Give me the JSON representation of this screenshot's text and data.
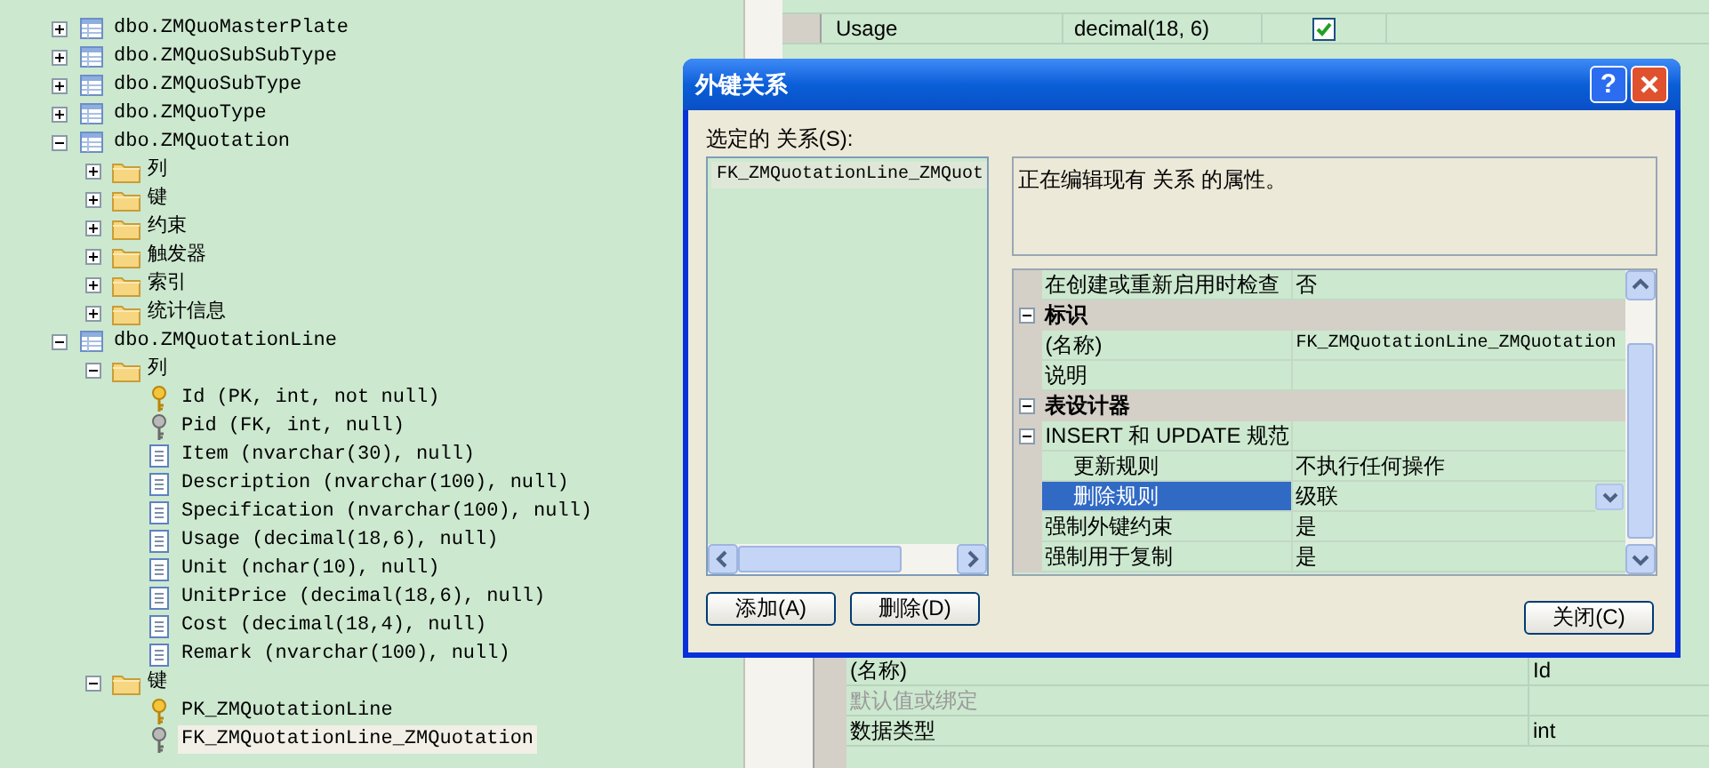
{
  "tree": [
    {
      "label": "dbo.ZMQuoMasterPlate",
      "kind": "table",
      "expanded": false,
      "selected": false
    },
    {
      "label": "dbo.ZMQuoSubSubType",
      "kind": "table",
      "expanded": false,
      "selected": false
    },
    {
      "label": "dbo.ZMQuoSubType",
      "kind": "table",
      "expanded": false,
      "selected": false
    },
    {
      "label": "dbo.ZMQuoType",
      "kind": "table",
      "expanded": false,
      "selected": false
    },
    {
      "label": "dbo.ZMQuotation",
      "kind": "table",
      "expanded": true,
      "selected": false,
      "children": [
        {
          "label": "列",
          "kind": "folder",
          "expanded": false,
          "selected": false
        },
        {
          "label": "键",
          "kind": "folder",
          "expanded": false,
          "selected": false
        },
        {
          "label": "约束",
          "kind": "folder",
          "expanded": false,
          "selected": false
        },
        {
          "label": "触发器",
          "kind": "folder",
          "expanded": false,
          "selected": false
        },
        {
          "label": "索引",
          "kind": "folder",
          "expanded": false,
          "selected": false
        },
        {
          "label": "统计信息",
          "kind": "folder",
          "expanded": false,
          "selected": false
        }
      ]
    },
    {
      "label": "dbo.ZMQuotationLine",
      "kind": "table",
      "expanded": true,
      "selected": false,
      "children": [
        {
          "label": "列",
          "kind": "folder",
          "expanded": true,
          "selected": false,
          "children": [
            {
              "label": "Id (PK, int, not null)",
              "kind": "primary",
              "selected": false
            },
            {
              "label": "Pid (FK, int, null)",
              "kind": "foreign",
              "selected": false
            },
            {
              "label": "Item (nvarchar(30), null)",
              "kind": "column",
              "selected": false
            },
            {
              "label": "Description (nvarchar(100), null)",
              "kind": "column",
              "selected": false
            },
            {
              "label": "Specification (nvarchar(100), null)",
              "kind": "column",
              "selected": false
            },
            {
              "label": "Usage (decimal(18,6), null)",
              "kind": "column",
              "selected": false
            },
            {
              "label": "Unit (nchar(10), null)",
              "kind": "column",
              "selected": false
            },
            {
              "label": "UnitPrice (decimal(18,6), null)",
              "kind": "column",
              "selected": false
            },
            {
              "label": "Cost (decimal(18,4), null)",
              "kind": "column",
              "selected": false
            },
            {
              "label": "Remark (nvarchar(100), null)",
              "kind": "column",
              "selected": false
            }
          ]
        },
        {
          "label": "键",
          "kind": "folder",
          "expanded": true,
          "selected": false,
          "children": [
            {
              "label": "PK_ZMQuotationLine",
              "kind": "primary",
              "selected": false
            },
            {
              "label": "FK_ZMQuotationLine_ZMQuotation",
              "kind": "foreign",
              "selected": true
            }
          ]
        }
      ]
    }
  ],
  "designer_grid": {
    "rows": [
      {
        "name": "Usage",
        "type": "decimal(18, 6)",
        "allow_nulls": true
      }
    ]
  },
  "column_properties": [
    {
      "name": "(名称)",
      "value": "Id",
      "disabled": false
    },
    {
      "name": "默认值或绑定",
      "disabled": true
    },
    {
      "name": "数据类型",
      "value": "int",
      "disabled": false
    }
  ],
  "dialog": {
    "title": "外键关系",
    "help": "?",
    "list_label": "选定的 关系(S):",
    "relationships": [
      {
        "label": "FK_ZMQuotationLine_ZMQuot",
        "selected": true
      }
    ],
    "description": "正在编辑现有 关系 的属性。",
    "properties": [
      {
        "kind": "property",
        "name": "在创建或重新启用时检查",
        "value": "否",
        "selected": false
      },
      {
        "kind": "category",
        "name": "标识",
        "expanded": true,
        "children": [
          {
            "kind": "property",
            "name": "(名称)",
            "value": "FK_ZMQuotationLine_ZMQuotation",
            "selected": false
          },
          {
            "kind": "property",
            "name": "说明",
            "selected": false
          }
        ]
      },
      {
        "kind": "category",
        "name": "表设计器",
        "expanded": true,
        "children": [
          {
            "kind": "property",
            "name": "INSERT 和 UPDATE 规范",
            "expanded": true,
            "selected": false,
            "children": [
              {
                "kind": "property",
                "name": "更新规则",
                "value": "不执行任何操作",
                "selected": false
              },
              {
                "kind": "property",
                "name": "删除规则",
                "value": "级联",
                "selected": true
              }
            ]
          },
          {
            "kind": "property",
            "name": "强制外键约束",
            "value": "是",
            "selected": false
          },
          {
            "kind": "property",
            "name": "强制用于复制",
            "value": "是",
            "selected": false
          }
        ]
      }
    ],
    "buttons": [
      "添加(A)",
      "删除(D)",
      "关闭(C)"
    ]
  }
}
